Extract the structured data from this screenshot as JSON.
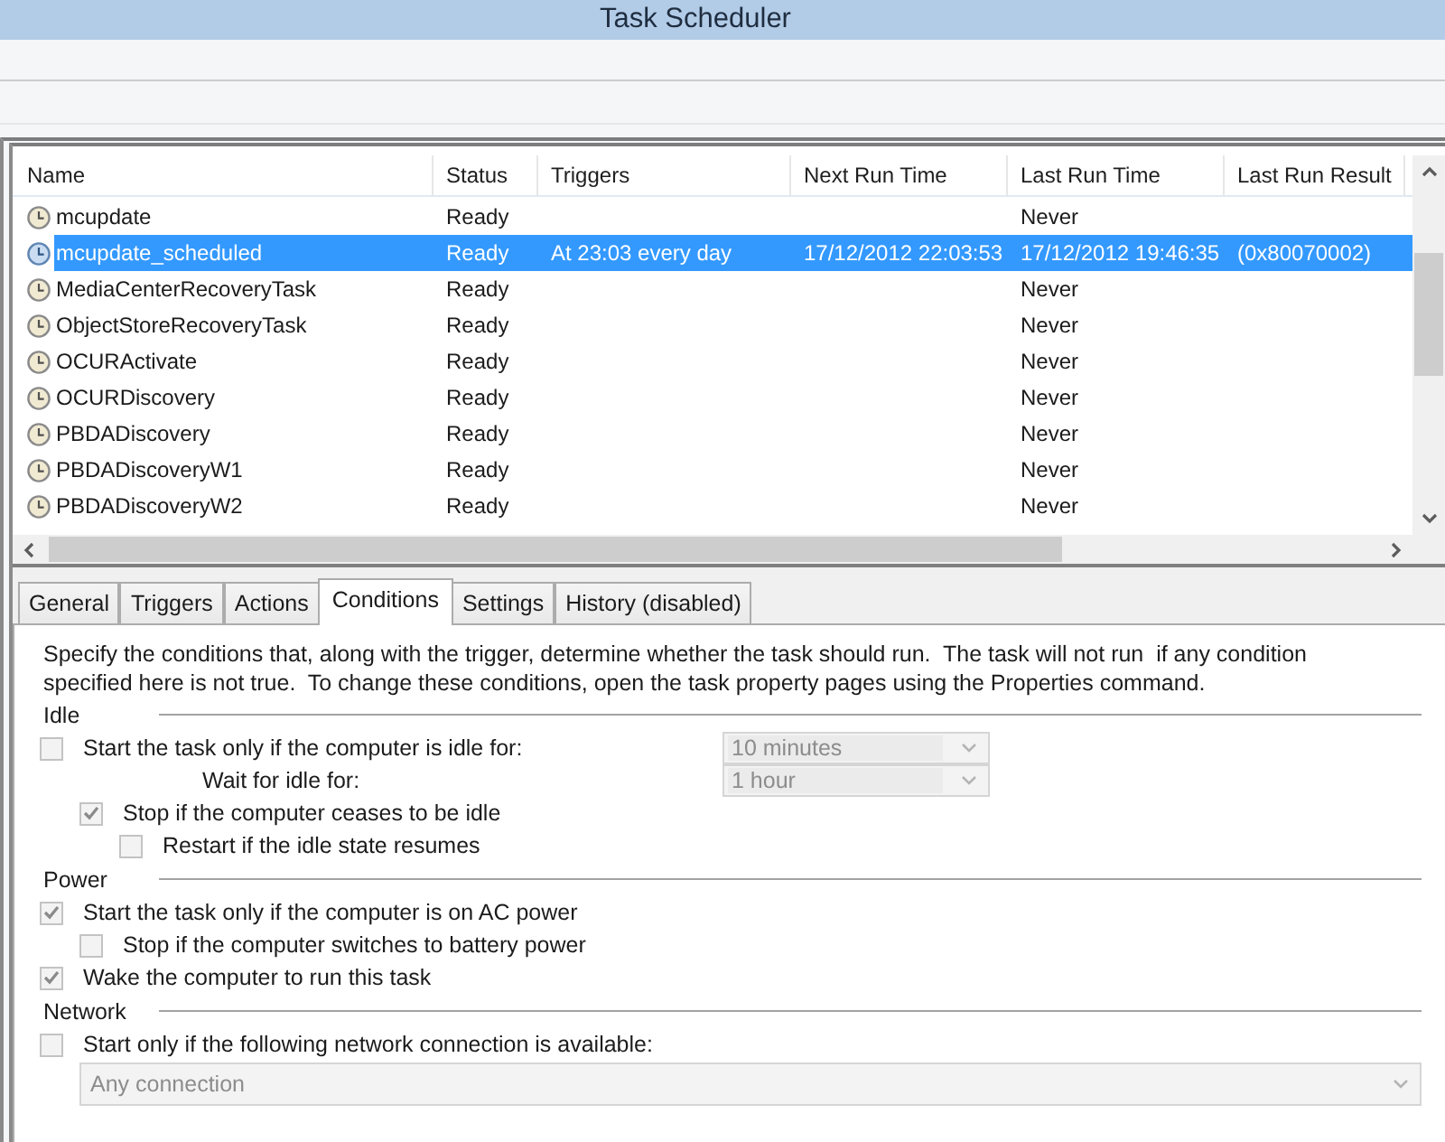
{
  "window": {
    "title": "Task Scheduler"
  },
  "task_list": {
    "columns": [
      "Name",
      "Status",
      "Triggers",
      "Next Run Time",
      "Last Run Time",
      "Last Run Result"
    ],
    "rows": [
      {
        "name": "mcupdate",
        "status": "Ready",
        "last_run_time": "Never",
        "selected": false
      },
      {
        "name": "mcupdate_scheduled",
        "status": "Ready",
        "triggers": "At 23:03 every day",
        "next_run_time": "17/12/2012 22:03:53",
        "last_run_time": "17/12/2012 19:46:35",
        "last_run_result": "(0x80070002)",
        "selected": true
      },
      {
        "name": "MediaCenterRecoveryTask",
        "status": "Ready",
        "last_run_time": "Never",
        "selected": false
      },
      {
        "name": "ObjectStoreRecoveryTask",
        "status": "Ready",
        "last_run_time": "Never",
        "selected": false
      },
      {
        "name": "OCURActivate",
        "status": "Ready",
        "last_run_time": "Never",
        "selected": false
      },
      {
        "name": "OCURDiscovery",
        "status": "Ready",
        "last_run_time": "Never",
        "selected": false
      },
      {
        "name": "PBDADiscovery",
        "status": "Ready",
        "last_run_time": "Never",
        "selected": false
      },
      {
        "name": "PBDADiscoveryW1",
        "status": "Ready",
        "last_run_time": "Never",
        "selected": false
      },
      {
        "name": "PBDADiscoveryW2",
        "status": "Ready",
        "last_run_time": "Never",
        "selected": false
      }
    ]
  },
  "tabs": [
    {
      "label": "General",
      "selected": false
    },
    {
      "label": "Triggers",
      "selected": false
    },
    {
      "label": "Actions",
      "selected": false
    },
    {
      "label": "Conditions",
      "selected": true
    },
    {
      "label": "Settings",
      "selected": false
    },
    {
      "label": "History (disabled)",
      "selected": false
    }
  ],
  "conditions": {
    "description": "Specify the conditions that, along with the trigger, determine whether the task should run.  The task will not run  if any condition specified here is not true.  To change these conditions, open the task property pages using the Properties command.",
    "sections": [
      {
        "title": "Idle",
        "items": [
          {
            "kind": "checkbox",
            "label": "Start the task only if the computer is idle for:",
            "checked": false,
            "dropdown": {
              "value": "10 minutes",
              "disabled": true
            },
            "children": [
              {
                "kind": "label",
                "label": "Wait for idle for:",
                "dropdown": {
                  "value": "1 hour",
                  "disabled": true
                }
              },
              {
                "kind": "checkbox",
                "label": "Stop if the computer ceases to be idle",
                "checked": true,
                "children": [
                  {
                    "kind": "checkbox",
                    "label": "Restart if the idle state resumes",
                    "checked": false
                  }
                ]
              }
            ]
          }
        ]
      },
      {
        "title": "Power",
        "items": [
          {
            "kind": "checkbox",
            "label": "Start the task only if the computer is on AC power",
            "checked": true,
            "children": [
              {
                "kind": "checkbox",
                "label": "Stop if the computer switches to battery power",
                "checked": false
              }
            ]
          },
          {
            "kind": "checkbox",
            "label": "Wake the computer to run this task",
            "checked": true
          }
        ]
      },
      {
        "title": "Network",
        "items": [
          {
            "kind": "checkbox",
            "label": "Start only if the following network connection is available:",
            "checked": false,
            "children": [
              {
                "kind": "dropdown",
                "value": "Any connection",
                "disabled": true
              }
            ]
          }
        ]
      }
    ]
  }
}
